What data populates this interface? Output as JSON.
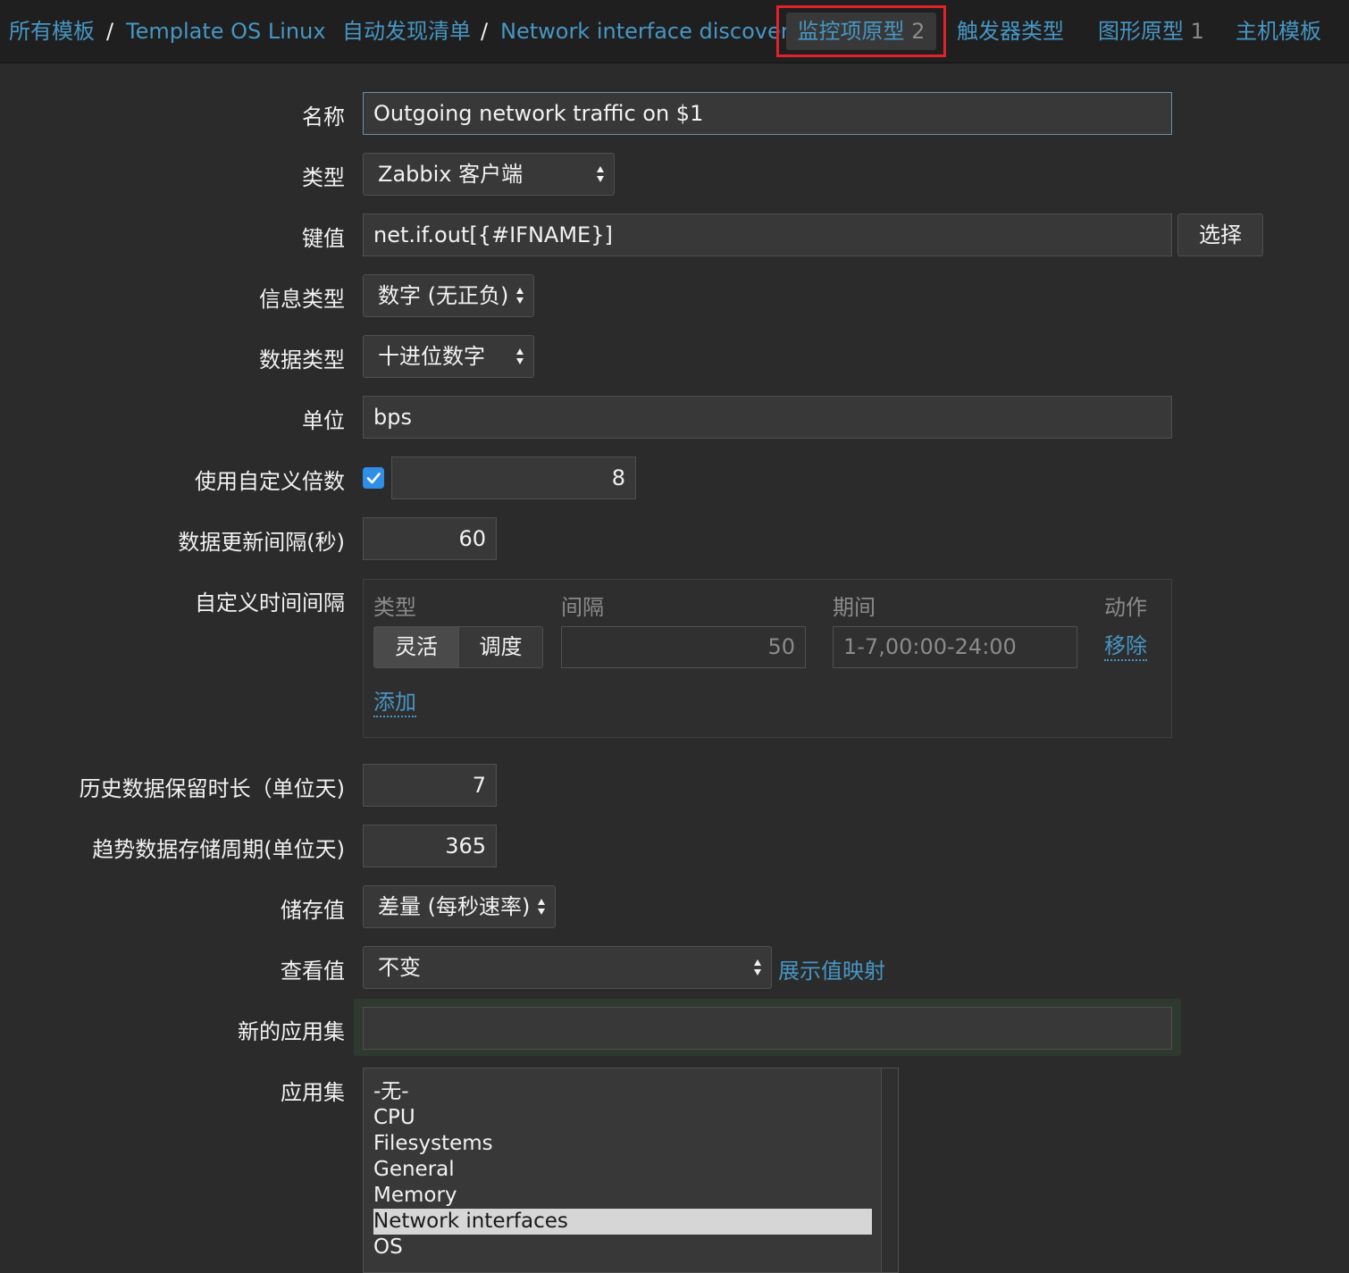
{
  "nav": {
    "all_templates": "所有模板",
    "sep": "/",
    "template": "Template OS Linux",
    "discovery_list": "自动发现清单",
    "discovery": "Network interface discovery",
    "item_prototypes": "监控项原型",
    "item_prototypes_count": "2",
    "trigger_prototypes": "触发器类型",
    "graph_prototypes": "图形原型",
    "graph_prototypes_count": "1",
    "host_templates": "主机模板"
  },
  "form": {
    "name": {
      "label": "名称",
      "value": "Outgoing network traffic on $1"
    },
    "type": {
      "label": "类型",
      "value": "Zabbix 客户端"
    },
    "key": {
      "label": "键值",
      "value": "net.if.out[{#IFNAME}]",
      "button": "选择"
    },
    "info_type": {
      "label": "信息类型",
      "value": "数字 (无正负)"
    },
    "data_type": {
      "label": "数据类型",
      "value": "十进位数字"
    },
    "units": {
      "label": "单位",
      "value": "bps"
    },
    "multiplier": {
      "label": "使用自定义倍数",
      "checked": true,
      "value": "8"
    },
    "update_interval": {
      "label": "数据更新间隔(秒)",
      "value": "60"
    },
    "custom_intervals": {
      "label": "自定义时间间隔",
      "headers": {
        "type": "类型",
        "interval": "间隔",
        "period": "期间",
        "action": "动作"
      },
      "row": {
        "flexible": "灵活",
        "scheduling": "调度",
        "interval": "50",
        "period": "1-7,00:00-24:00",
        "remove": "移除"
      },
      "add": "添加"
    },
    "history": {
      "label": "历史数据保留时长（单位天)",
      "value": "7"
    },
    "trends": {
      "label": "趋势数据存储周期(单位天)",
      "value": "365"
    },
    "store_value": {
      "label": "储存值",
      "value": "差量 (每秒速率)"
    },
    "show_value": {
      "label": "查看值",
      "value": "不变",
      "link": "展示值映射"
    },
    "new_application": {
      "label": "新的应用集",
      "value": ""
    },
    "applications": {
      "label": "应用集",
      "items": [
        "-无-",
        "CPU",
        "Filesystems",
        "General",
        "Memory",
        "Network interfaces",
        "OS"
      ],
      "selected": "Network interfaces"
    }
  },
  "colors": {
    "link": "#4796c4",
    "highlight_border": "#e0222c",
    "checkbox": "#2f8fe8"
  }
}
